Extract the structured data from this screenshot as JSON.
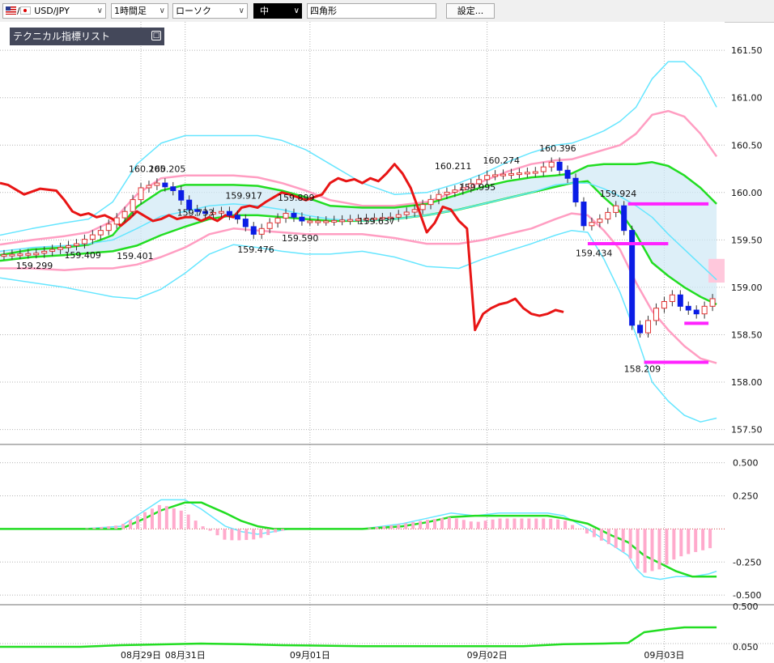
{
  "toolbar": {
    "pair": "USD/JPY",
    "timeframe": "1時間足",
    "chart_style": "ローソク",
    "line_width": "中",
    "drawing_tool": "四角形",
    "settings_label": "設定..."
  },
  "indicator_panel": {
    "title": "テクニカル指標リスト",
    "toggle": "□"
  },
  "colors": {
    "up_candle": "#e23333",
    "down_candle": "#0b1de6",
    "bollinger_inner": "#ff9ec2",
    "bollinger_outer": "#66e6ff",
    "ma": "#22dd22",
    "rci": "#e81515",
    "macd_hist": "#ffaacc",
    "levels": "#ff22ff"
  },
  "chart_data": {
    "type": "line",
    "price_axis": {
      "ticks": [
        "161.50",
        "161.00",
        "160.50",
        "160.00",
        "159.50",
        "159.00",
        "158.50",
        "158.00",
        "157.50"
      ],
      "range": [
        157.36,
        161.8
      ]
    },
    "macd_axis": {
      "ticks": [
        "0.500",
        "0.250",
        "-0.250",
        "-0.500"
      ],
      "range": [
        -0.56,
        0.62
      ]
    },
    "bottom_axis": {
      "ticks": [
        "0.500",
        "0.050"
      ]
    },
    "time_labels": [
      "08月29日",
      "08月31日",
      "09月01日",
      "09月02日",
      "09月03日"
    ],
    "price_labels": [
      {
        "text": "160.205",
        "x": 36,
        "y": 160.18
      },
      {
        "text": "160.205",
        "x": 41,
        "y": 160.18
      },
      {
        "text": "160.211",
        "x": 112,
        "y": 160.21
      },
      {
        "text": "160.274",
        "x": 124,
        "y": 160.27
      },
      {
        "text": "160.396",
        "x": 138,
        "y": 160.4
      },
      {
        "text": "159.917",
        "x": 60,
        "y": 159.9
      },
      {
        "text": "159.899",
        "x": 73,
        "y": 159.88
      },
      {
        "text": "159.924",
        "x": 153,
        "y": 159.92
      },
      {
        "text": "159.733",
        "x": 48,
        "y": 159.72
      },
      {
        "text": "159.995",
        "x": 118,
        "y": 159.99
      },
      {
        "text": "159.637",
        "x": 93,
        "y": 159.63
      },
      {
        "text": "159.590",
        "x": 74,
        "y": 159.59
      },
      {
        "text": "159.476",
        "x": 63,
        "y": 159.47
      },
      {
        "text": "159.434",
        "x": 147,
        "y": 159.43
      },
      {
        "text": "159.409",
        "x": 20,
        "y": 159.41
      },
      {
        "text": "159.401",
        "x": 33,
        "y": 159.4
      },
      {
        "text": "159.299",
        "x": 8,
        "y": 159.3
      },
      {
        "text": "158.209",
        "x": 159,
        "y": 158.21
      }
    ],
    "series": [
      {
        "name": "BB upper 2σ",
        "kind": "price",
        "color": "outer",
        "x": [
          0,
          8,
          16,
          22,
          28,
          34,
          40,
          46,
          52,
          58,
          64,
          70,
          76,
          82,
          90,
          98,
          106,
          114,
          120,
          126,
          132,
          138,
          142,
          146,
          150,
          154,
          158,
          162,
          166,
          170,
          174,
          178
        ],
        "values": [
          159.55,
          159.62,
          159.68,
          159.72,
          159.9,
          160.3,
          160.52,
          160.6,
          160.6,
          160.6,
          160.6,
          160.55,
          160.45,
          160.3,
          160.1,
          159.98,
          160.0,
          160.1,
          160.2,
          160.32,
          160.42,
          160.5,
          160.52,
          160.58,
          160.65,
          160.75,
          160.9,
          161.2,
          161.38,
          161.38,
          161.22,
          160.9
        ]
      },
      {
        "name": "BB upper 1σ",
        "kind": "price",
        "color": "inner",
        "x": [
          0,
          8,
          16,
          22,
          28,
          34,
          40,
          46,
          52,
          58,
          64,
          70,
          76,
          82,
          90,
          98,
          106,
          114,
          120,
          126,
          132,
          138,
          142,
          146,
          150,
          154,
          158,
          162,
          166,
          170,
          174,
          178
        ],
        "values": [
          159.45,
          159.5,
          159.54,
          159.58,
          159.7,
          159.98,
          160.15,
          160.18,
          160.18,
          160.18,
          160.16,
          160.1,
          160.02,
          159.92,
          159.86,
          159.86,
          159.9,
          160.02,
          160.12,
          160.22,
          160.3,
          160.34,
          160.35,
          160.4,
          160.45,
          160.5,
          160.62,
          160.82,
          160.86,
          160.8,
          160.62,
          160.38
        ]
      },
      {
        "name": "MA upper",
        "kind": "price",
        "color": "ma",
        "x": [
          0,
          8,
          16,
          22,
          28,
          34,
          40,
          46,
          52,
          58,
          64,
          70,
          76,
          82,
          90,
          98,
          106,
          114,
          120,
          126,
          132,
          138,
          142,
          146,
          150,
          154,
          158,
          162,
          166,
          170,
          174,
          178
        ],
        "values": [
          159.34,
          159.4,
          159.42,
          159.45,
          159.55,
          159.85,
          160.02,
          160.08,
          160.08,
          160.08,
          160.07,
          160.02,
          159.95,
          159.86,
          159.84,
          159.84,
          159.88,
          159.98,
          160.06,
          160.12,
          160.16,
          160.18,
          160.2,
          160.28,
          160.3,
          160.3,
          160.3,
          160.32,
          160.28,
          160.18,
          160.05,
          159.88
        ]
      },
      {
        "name": "MA lower",
        "kind": "price",
        "color": "ma",
        "x": [
          0,
          8,
          16,
          22,
          28,
          34,
          40,
          46,
          52,
          58,
          64,
          70,
          76,
          82,
          90,
          98,
          106,
          114,
          120,
          126,
          132,
          138,
          142,
          146,
          150,
          154,
          158,
          162,
          166,
          170,
          174,
          178
        ],
        "values": [
          159.28,
          159.32,
          159.34,
          159.36,
          159.38,
          159.44,
          159.55,
          159.64,
          159.72,
          159.76,
          159.76,
          159.74,
          159.72,
          159.7,
          159.7,
          159.72,
          159.76,
          159.82,
          159.88,
          159.94,
          160.0,
          160.06,
          160.1,
          160.12,
          159.95,
          159.8,
          159.56,
          159.26,
          159.12,
          159.0,
          158.9,
          158.82
        ]
      },
      {
        "name": "Signal cyan",
        "kind": "price",
        "color": "outer",
        "x": [
          0,
          8,
          16,
          22,
          28,
          34,
          40,
          46,
          52,
          58,
          64,
          70,
          76,
          82,
          90,
          98,
          106,
          114,
          120,
          126,
          132,
          138,
          142,
          146,
          150,
          154,
          158,
          162,
          166,
          170,
          174,
          178
        ],
        "values": [
          159.38,
          159.42,
          159.44,
          159.46,
          159.5,
          159.62,
          159.75,
          159.8,
          159.86,
          159.88,
          159.86,
          159.82,
          159.76,
          159.72,
          159.7,
          159.72,
          159.76,
          159.82,
          159.88,
          159.94,
          160.0,
          160.08,
          160.1,
          160.1,
          160.04,
          159.96,
          159.86,
          159.74,
          159.56,
          159.4,
          159.24,
          159.08
        ]
      },
      {
        "name": "BB lower 1σ",
        "kind": "price",
        "color": "inner",
        "x": [
          0,
          8,
          16,
          22,
          28,
          34,
          40,
          46,
          52,
          58,
          64,
          70,
          76,
          82,
          90,
          98,
          106,
          114,
          120,
          126,
          132,
          138,
          142,
          146,
          150,
          154,
          158,
          162,
          166,
          170,
          174,
          178
        ],
        "values": [
          159.2,
          159.2,
          159.18,
          159.2,
          159.2,
          159.24,
          159.32,
          159.42,
          159.56,
          159.62,
          159.6,
          159.58,
          159.56,
          159.56,
          159.56,
          159.52,
          159.46,
          159.46,
          159.5,
          159.56,
          159.62,
          159.72,
          159.78,
          159.76,
          159.6,
          159.4,
          159.05,
          158.75,
          158.55,
          158.38,
          158.25,
          158.2
        ]
      },
      {
        "name": "BB lower 2σ",
        "kind": "price",
        "color": "outer",
        "x": [
          0,
          8,
          16,
          22,
          28,
          34,
          40,
          46,
          52,
          58,
          64,
          70,
          76,
          82,
          90,
          98,
          106,
          114,
          120,
          126,
          132,
          138,
          142,
          146,
          150,
          154,
          158,
          162,
          166,
          170,
          174,
          178
        ],
        "values": [
          159.1,
          159.05,
          159.0,
          158.95,
          158.9,
          158.88,
          158.98,
          159.15,
          159.35,
          159.45,
          159.42,
          159.38,
          159.35,
          159.35,
          159.38,
          159.32,
          159.22,
          159.2,
          159.3,
          159.38,
          159.46,
          159.55,
          159.6,
          159.58,
          159.3,
          158.95,
          158.5,
          158.0,
          157.8,
          157.65,
          157.58,
          157.62
        ]
      },
      {
        "name": "RCI",
        "kind": "price",
        "color": "rci",
        "x": [
          0,
          2,
          6,
          10,
          14,
          16,
          18,
          20,
          22,
          24,
          26,
          28,
          30,
          32,
          34,
          36,
          38,
          40,
          42,
          44,
          46,
          48,
          50,
          52,
          54,
          56,
          58,
          60,
          62,
          64,
          66,
          68,
          70,
          72,
          74,
          76,
          78,
          80,
          82,
          84,
          86,
          88,
          90,
          92,
          94,
          96,
          98,
          100,
          102,
          104,
          106,
          108,
          110,
          112,
          114,
          116,
          118,
          120,
          122,
          124,
          126,
          128,
          130,
          132,
          134,
          136,
          138,
          140
        ],
        "values": [
          160.1,
          160.08,
          159.98,
          160.04,
          160.02,
          159.92,
          159.8,
          159.76,
          159.78,
          159.74,
          159.76,
          159.72,
          159.65,
          159.72,
          159.8,
          159.75,
          159.7,
          159.72,
          159.76,
          159.72,
          159.74,
          159.74,
          159.7,
          159.74,
          159.7,
          159.76,
          159.74,
          159.84,
          159.86,
          159.84,
          159.9,
          159.95,
          160.0,
          159.98,
          159.95,
          159.92,
          159.95,
          159.98,
          160.1,
          160.15,
          160.12,
          160.14,
          160.1,
          160.15,
          160.12,
          160.2,
          160.3,
          160.2,
          160.05,
          159.82,
          159.58,
          159.68,
          159.85,
          159.82,
          159.7,
          159.62,
          158.55,
          158.72,
          158.78,
          158.82,
          158.84,
          158.88,
          158.78,
          158.72,
          158.7,
          158.72,
          158.76,
          158.74
        ]
      },
      {
        "name": "MACD cyan",
        "kind": "macd",
        "color": "outer",
        "x": [
          0,
          10,
          20,
          30,
          36,
          40,
          46,
          50,
          56,
          60,
          64,
          68,
          72,
          80,
          90,
          100,
          106,
          112,
          118,
          124,
          130,
          136,
          140,
          146,
          152,
          156,
          158,
          160,
          164,
          168,
          172,
          176,
          178
        ],
        "values": [
          0.0,
          0.0,
          0.0,
          0.02,
          0.14,
          0.22,
          0.22,
          0.15,
          0.02,
          -0.02,
          -0.04,
          -0.02,
          0.0,
          0.0,
          0.0,
          0.04,
          0.08,
          0.12,
          0.1,
          0.12,
          0.12,
          0.12,
          0.1,
          0.0,
          -0.12,
          -0.2,
          -0.3,
          -0.36,
          -0.38,
          -0.36,
          -0.36,
          -0.34,
          -0.32
        ]
      },
      {
        "name": "MACD green",
        "kind": "macd",
        "color": "ma",
        "x": [
          0,
          10,
          20,
          30,
          36,
          40,
          46,
          50,
          56,
          60,
          64,
          68,
          72,
          80,
          90,
          100,
          106,
          112,
          118,
          124,
          130,
          136,
          140,
          146,
          152,
          156,
          158,
          160,
          164,
          168,
          172,
          176,
          178
        ],
        "values": [
          0.0,
          0.0,
          0.0,
          0.0,
          0.08,
          0.14,
          0.2,
          0.2,
          0.12,
          0.06,
          0.02,
          0.0,
          0.0,
          0.0,
          0.0,
          0.02,
          0.05,
          0.09,
          0.1,
          0.1,
          0.1,
          0.1,
          0.08,
          0.04,
          -0.05,
          -0.1,
          -0.15,
          -0.2,
          -0.26,
          -0.32,
          -0.36,
          -0.36,
          -0.36
        ]
      },
      {
        "name": "Bottom green",
        "kind": "bottom",
        "color": "ma",
        "x": [
          0,
          20,
          30,
          50,
          60,
          70,
          90,
          100,
          110,
          120,
          130,
          140,
          150,
          156,
          160,
          166,
          170,
          178
        ],
        "values": [
          0.0,
          0.0,
          0.05,
          0.1,
          0.08,
          0.05,
          0.02,
          0.02,
          0.02,
          0.02,
          0.02,
          0.08,
          0.1,
          0.12,
          0.45,
          0.55,
          0.6,
          0.6
        ]
      }
    ],
    "levels": [
      {
        "x0": 156,
        "x1": 176,
        "y": 159.88
      },
      {
        "x0": 146,
        "x1": 166,
        "y": 159.46
      },
      {
        "x0": 170,
        "x1": 176,
        "y": 158.62
      },
      {
        "x0": 160,
        "x1": 176,
        "y": 158.21
      }
    ]
  }
}
